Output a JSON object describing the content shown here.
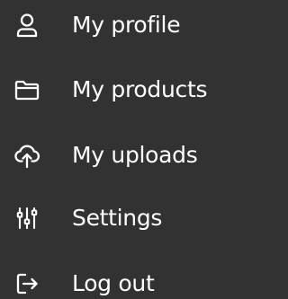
{
  "menu": {
    "items": [
      {
        "label": "My profile",
        "icon": "user-icon"
      },
      {
        "label": "My products",
        "icon": "folder-icon"
      },
      {
        "label": "My uploads",
        "icon": "cloud-upload-icon"
      },
      {
        "label": "Settings",
        "icon": "sliders-icon"
      },
      {
        "label": "Log out",
        "icon": "logout-icon"
      }
    ]
  },
  "colors": {
    "background": "#333232",
    "text": "#ffffff",
    "icon": "#ffffff"
  }
}
